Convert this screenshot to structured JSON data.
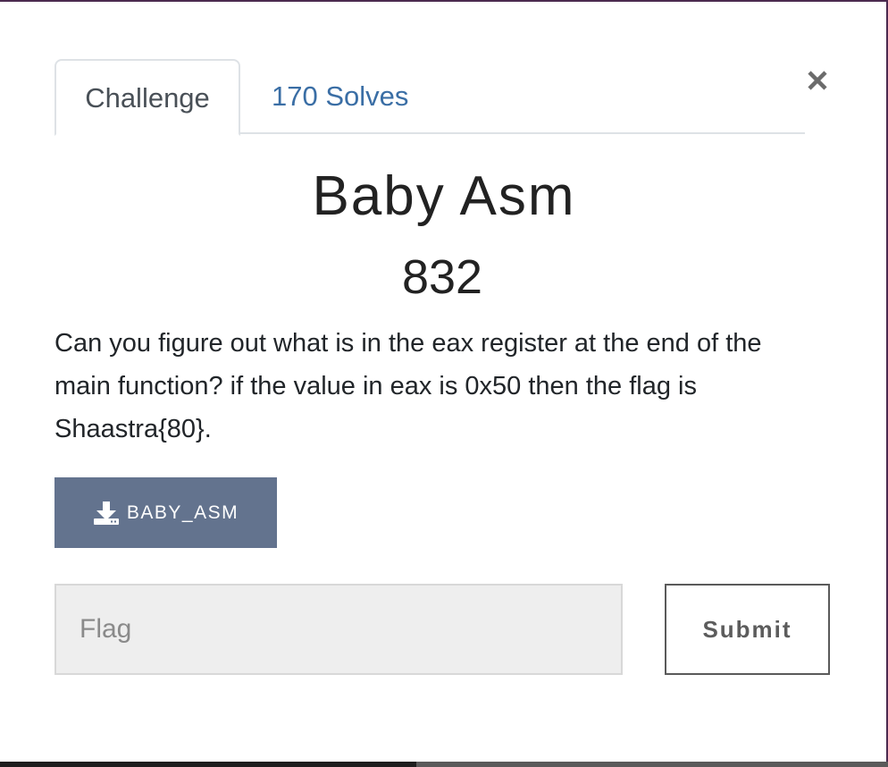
{
  "modal": {
    "tabs": [
      {
        "label": "Challenge",
        "active": true
      },
      {
        "label": "170 Solves",
        "active": false
      }
    ],
    "close_icon": "close-icon"
  },
  "challenge": {
    "name": "Baby Asm",
    "points": "832",
    "description": "Can you figure out what is in the eax register at the end of the main function? if the value in eax is 0x50 then the flag is Shaastra{80}.",
    "file_button_label": "BABY_ASM",
    "file_icon": "download-icon"
  },
  "form": {
    "flag_placeholder": "Flag",
    "flag_value": "",
    "submit_label": "Submit"
  },
  "colors": {
    "tab_link": "#3a6ea5",
    "download_button_bg": "#63738e",
    "input_bg": "#eeeeee",
    "submit_border": "#5a5a5a"
  }
}
